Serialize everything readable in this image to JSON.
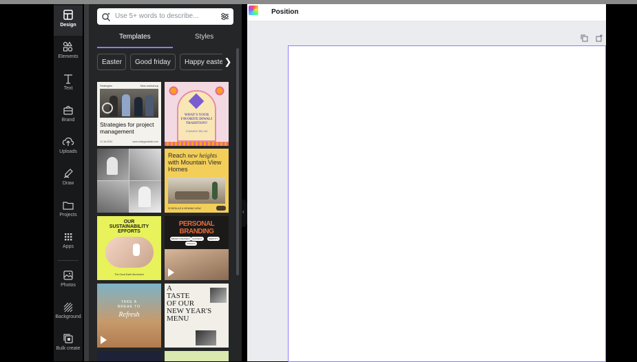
{
  "rail": {
    "items": [
      {
        "label": "Design",
        "icon": "design-icon",
        "active": true
      },
      {
        "label": "Elements",
        "icon": "elements-icon"
      },
      {
        "label": "Text",
        "icon": "text-icon"
      },
      {
        "label": "Brand",
        "icon": "brand-icon"
      },
      {
        "label": "Uploads",
        "icon": "uploads-icon"
      },
      {
        "label": "Draw",
        "icon": "draw-icon"
      },
      {
        "label": "Projects",
        "icon": "projects-icon"
      },
      {
        "label": "Apps",
        "icon": "apps-icon"
      },
      {
        "label": "Photos",
        "icon": "photos-icon"
      },
      {
        "label": "Background",
        "icon": "background-icon"
      },
      {
        "label": "Bulk create",
        "icon": "bulk-create-icon"
      }
    ]
  },
  "panel": {
    "search_placeholder": "Use 5+ words to describe...",
    "tabs": [
      "Templates",
      "Styles"
    ],
    "chips": [
      "Easter",
      "Good friday",
      "Happy easter"
    ],
    "thumbs": {
      "t1": {
        "header_left": "Strategies",
        "header_right": "New workshop",
        "title": "Strategies for project management",
        "footer_left": "12 Jul 2024",
        "footer_right": "www.reallygreatsite.com"
      },
      "t2": {
        "title": "WHAT'S YOUR FAVORITE DIWALI TRADITION?",
        "sub": "COMMENT BELOW"
      },
      "t4": {
        "title_a": "Reach ",
        "title_script": "new heights",
        "title_b": "with Mountain View Homes",
        "cta": "SCHEDULE A VIEWING NOW"
      },
      "t5": {
        "title": "OUR SUSTAINABILITY EFFORTS",
        "footer": "The Good Earth Movement"
      },
      "t6": {
        "title": "PERSONAL BRANDING",
        "pill1": "BRAND STRATEGY",
        "pill2": "CONTENT",
        "pill3": "IDENTITY",
        "pill4": "VISUALS"
      },
      "t7": {
        "line1": "TAKE A",
        "line2": "BREAK TO",
        "script": "Refresh"
      },
      "t8": {
        "lines": [
          "A",
          "TASTE",
          "OF OUR",
          "NEW",
          "YEAR'S",
          "MENU"
        ]
      }
    }
  },
  "editor": {
    "position_label": "Position"
  },
  "colors": {
    "accent": "#8b7cf6",
    "rail_bg": "#18191b",
    "panel_bg": "#252627"
  }
}
